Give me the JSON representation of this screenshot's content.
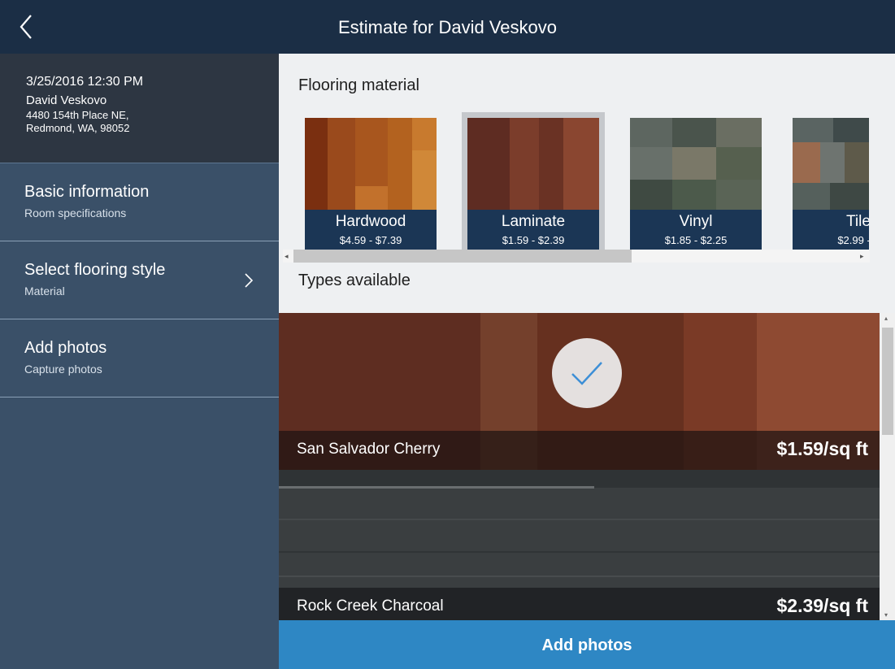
{
  "header": {
    "title": "Estimate for David Veskovo",
    "back_icon": "chevron-left-icon"
  },
  "summary": {
    "datetime": "3/25/2016 12:30 PM",
    "name": "David Veskovo",
    "address_line1": "4480 154th Place NE,",
    "address_line2": "Redmond, WA, 98052"
  },
  "nav": {
    "items": [
      {
        "title": "Basic information",
        "subtitle": "Room specifications"
      },
      {
        "title": "Select flooring style",
        "subtitle": "Material",
        "icon": "chevron-right-icon"
      },
      {
        "title": "Add photos",
        "subtitle": "Capture photos"
      }
    ]
  },
  "flooring": {
    "title": "Flooring material",
    "materials": [
      {
        "name": "Hardwood",
        "price": "$4.59 - $7.39",
        "selected": false
      },
      {
        "name": "Laminate",
        "price": "$1.59 - $2.39",
        "selected": true
      },
      {
        "name": "Vinyl",
        "price": "$1.85 - $2.25",
        "selected": false
      },
      {
        "name": "Tile",
        "price": "$2.99 - $",
        "selected": false
      }
    ]
  },
  "types": {
    "title": "Types available",
    "items": [
      {
        "name": "San Salvador Cherry",
        "price": "$1.59/sq ft",
        "selected": true,
        "icon": "checkmark-icon"
      },
      {
        "name": "Rock Creek Charcoal",
        "price": "$2.39/sq ft",
        "selected": false
      }
    ]
  },
  "footer": {
    "add_photos_label": "Add photos"
  },
  "colors": {
    "header": "#1b2e45",
    "sidebar": "#3a5068",
    "summary": "#2d3642",
    "label_bar": "#1b3655",
    "accent": "#2e87c4"
  }
}
